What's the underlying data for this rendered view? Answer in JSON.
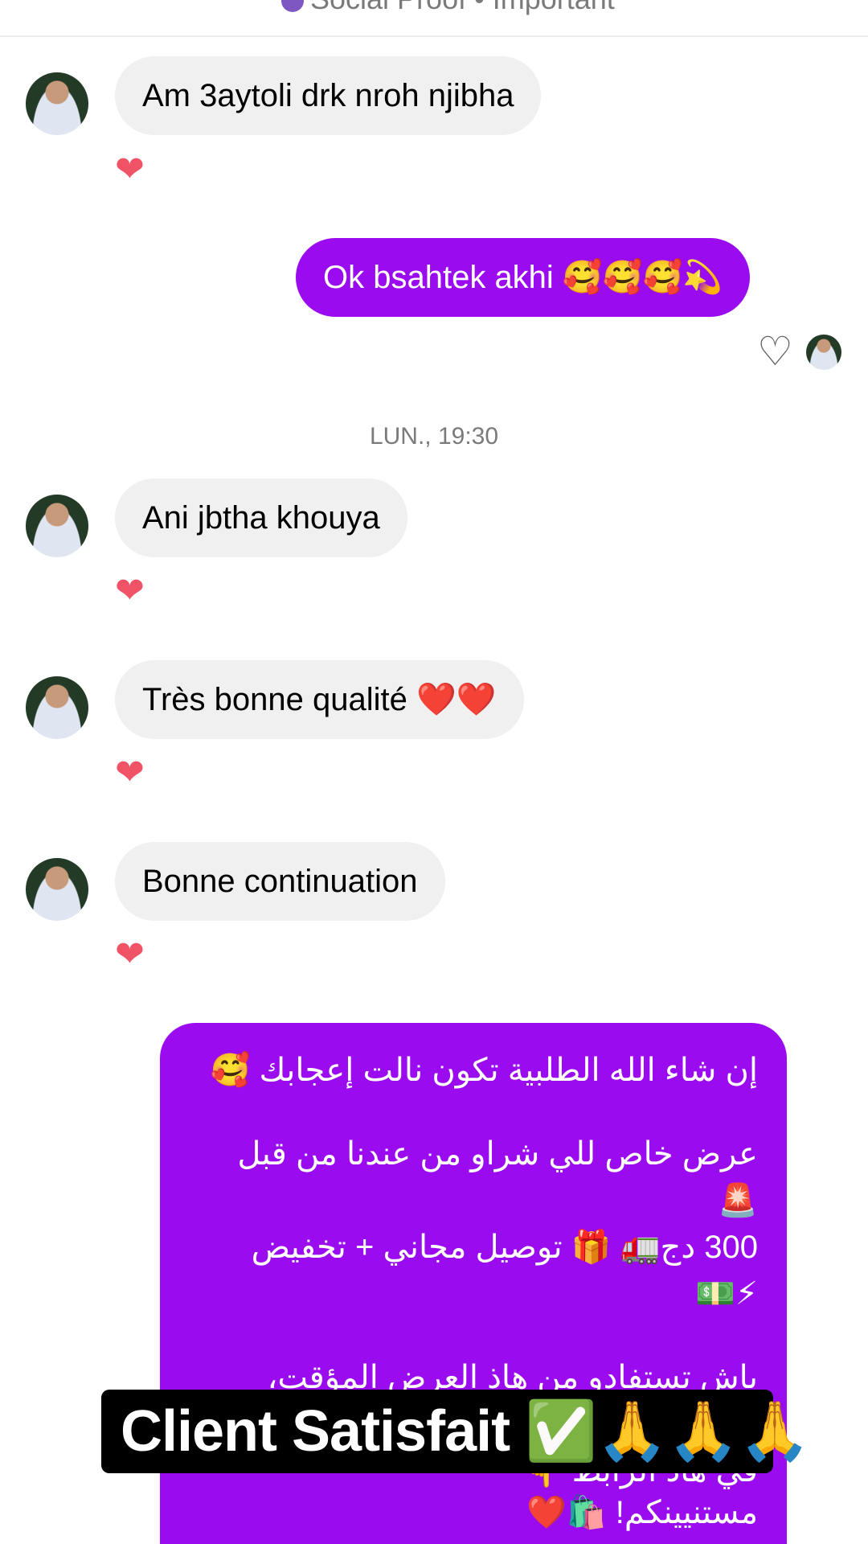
{
  "header": {
    "tags_text": "Social Proof • Important"
  },
  "messages": [
    {
      "text": "Am 3aytoli drk nroh njibha",
      "reaction": "❤"
    },
    {
      "text": "Ok bsahtek akhi 🥰🥰🥰💫",
      "reaction": "♡"
    },
    {
      "text": "Ani jbtha khouya",
      "reaction": "❤"
    },
    {
      "text": "Très bonne qualité ❤️❤️",
      "reaction": "❤"
    },
    {
      "text": "Bonne continuation",
      "reaction": "❤"
    }
  ],
  "timestamp": "LUN., 19:30",
  "offer_message": {
    "line1": "إن شاء الله الطلبية تكون نالت إعجابك 🥰",
    "line2": "عرض خاص للي شراو من عندنا من قبل 🚨",
    "line3": "300 دج🚛 🎁 توصيل مجاني + تخفيض",
    "line4": "⚡💵",
    "line5": "باش تستفادو من هاذ العرض المؤقت، إدخلو",
    "line6": "في هاذ الرابط 👇",
    "line7": "مستنيينكم! 🛍️❤️"
  },
  "overlay": {
    "banner_text": "Client Satisfait ✅🙏🙏🙏"
  },
  "colors": {
    "outgoing_bubble": "#9a0cef",
    "incoming_bubble": "#f0f0f0",
    "reaction_heart": "#f05366"
  }
}
